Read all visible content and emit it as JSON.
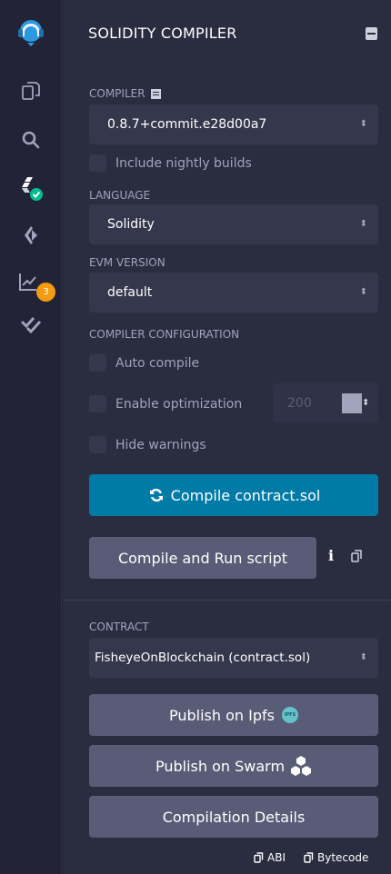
{
  "panel": {
    "title": "SOLIDITY COMPILER"
  },
  "icons": [
    "remix-logo-icon",
    "file-explorer-icon",
    "search-icon",
    "solidity-compiler-icon",
    "deploy-run-icon",
    "analysis-icon",
    "test-icon",
    "panel-toggle-icon"
  ],
  "sidebar": {
    "analysis_badge": "3"
  },
  "compiler": {
    "label": "COMPILER",
    "version": "0.8.7+commit.e28d00a7",
    "nightly_label": "Include nightly builds"
  },
  "language": {
    "label": "LANGUAGE",
    "value": "Solidity"
  },
  "evm": {
    "label": "EVM VERSION",
    "value": "default"
  },
  "config": {
    "label": "COMPILER CONFIGURATION",
    "auto_compile": "Auto compile",
    "enable_optimization": "Enable optimization",
    "runs_value": "200",
    "hide_warnings": "Hide warnings"
  },
  "actions": {
    "compile_label": "Compile contract.sol",
    "compile_run_label": "Compile and Run script"
  },
  "contract": {
    "label": "CONTRACT",
    "value": "FisheyeOnBlockchain (contract.sol)"
  },
  "publish": {
    "ipfs_label": "Publish on Ipfs",
    "ipfs_badge": "IPFS",
    "swarm_label": "Publish on Swarm",
    "details_label": "Compilation Details"
  },
  "footer": {
    "abi_label": "ABI",
    "bytecode_label": "Bytecode"
  },
  "colors": {
    "accent": "#007aa6",
    "success": "#00bc8c",
    "warning": "#f39c12"
  }
}
